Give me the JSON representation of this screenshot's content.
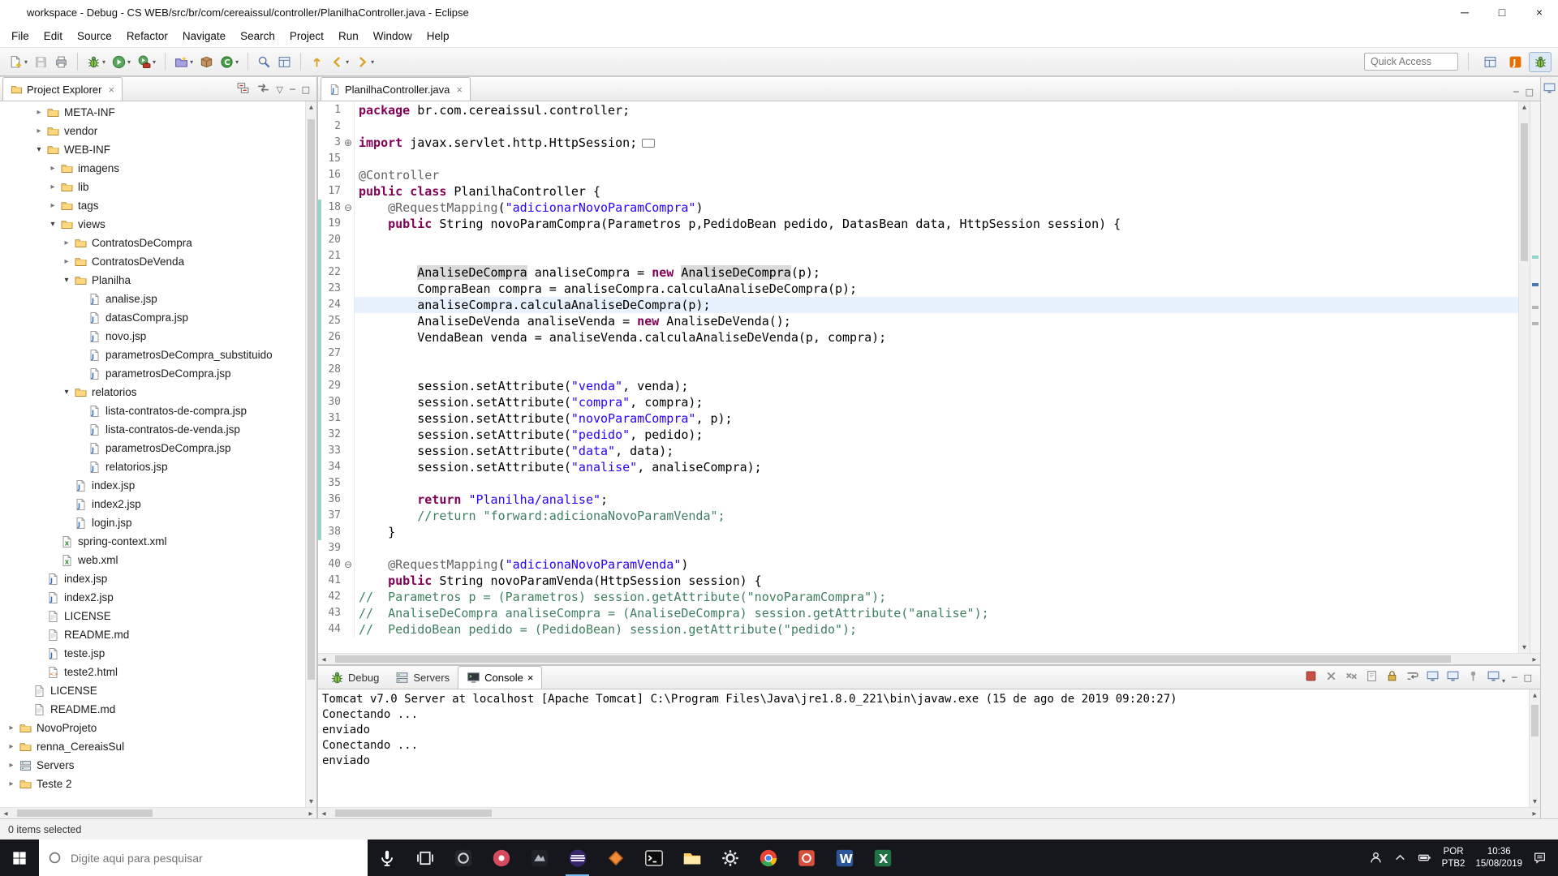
{
  "window": {
    "title": "workspace - Debug - CS WEB/src/br/com/cereaissul/controller/PlanilhaController.java - Eclipse"
  },
  "menu": {
    "items": [
      "File",
      "Edit",
      "Source",
      "Refactor",
      "Navigate",
      "Search",
      "Project",
      "Run",
      "Window",
      "Help"
    ]
  },
  "toolbar": {
    "quick_access_placeholder": "Quick Access",
    "groups": [
      [
        {
          "name": "new",
          "icon": "new-wizard",
          "dd": true
        },
        {
          "name": "save",
          "icon": "save",
          "disabled": true
        },
        {
          "name": "print",
          "icon": "print"
        }
      ],
      [
        {
          "name": "debug",
          "icon": "bug",
          "dd": true
        },
        {
          "name": "run",
          "icon": "run",
          "dd": true
        },
        {
          "name": "external-tools",
          "icon": "run-tool",
          "dd": true
        }
      ],
      [
        {
          "name": "new-java-project",
          "icon": "new-project",
          "dd": true
        },
        {
          "name": "new-package",
          "icon": "new-package"
        },
        {
          "name": "new-class",
          "icon": "new-class",
          "dd": true
        }
      ],
      [
        {
          "name": "search",
          "icon": "search"
        },
        {
          "name": "open-type",
          "icon": "grid"
        }
      ],
      [
        {
          "name": "last-edit-location",
          "icon": "last-edit"
        },
        {
          "name": "back",
          "icon": "back",
          "dd": true
        },
        {
          "name": "forward",
          "icon": "forward",
          "dd": true
        }
      ]
    ],
    "perspectives": [
      {
        "name": "open-perspective",
        "icon": "grid",
        "active": false
      },
      {
        "name": "javaee-perspective",
        "icon": "java",
        "active": false
      },
      {
        "name": "debug-perspective",
        "icon": "bug",
        "active": true
      }
    ]
  },
  "explorer": {
    "tab": "Project Explorer",
    "header_icons": [
      {
        "name": "collapse-all",
        "icon": "collapse-all"
      },
      {
        "name": "link-with-editor",
        "icon": "link"
      },
      {
        "name": "view-menu",
        "glyph": "▽"
      },
      {
        "name": "minimize-view",
        "glyph": "─"
      },
      {
        "name": "maximize-view",
        "glyph": "□"
      }
    ],
    "items": [
      {
        "label": "META-INF",
        "depth": 2,
        "icon": "folder",
        "state": "collapsed"
      },
      {
        "label": "vendor",
        "depth": 2,
        "icon": "folder",
        "state": "collapsed"
      },
      {
        "label": "WEB-INF",
        "depth": 2,
        "icon": "folder",
        "state": "expanded"
      },
      {
        "label": "imagens",
        "depth": 3,
        "icon": "folder",
        "state": "collapsed"
      },
      {
        "label": "lib",
        "depth": 3,
        "icon": "folder",
        "state": "collapsed"
      },
      {
        "label": "tags",
        "depth": 3,
        "icon": "folder",
        "state": "collapsed"
      },
      {
        "label": "views",
        "depth": 3,
        "icon": "folder",
        "state": "expanded"
      },
      {
        "label": "ContratosDeCompra",
        "depth": 4,
        "icon": "folder",
        "state": "collapsed"
      },
      {
        "label": "ContratosDeVenda",
        "depth": 4,
        "icon": "folder",
        "state": "collapsed"
      },
      {
        "label": "Planilha",
        "depth": 4,
        "icon": "folder",
        "state": "expanded"
      },
      {
        "label": "analise.jsp",
        "depth": 5,
        "icon": "jsp",
        "state": "leaf"
      },
      {
        "label": "datasCompra.jsp",
        "depth": 5,
        "icon": "jsp",
        "state": "leaf"
      },
      {
        "label": "novo.jsp",
        "depth": 5,
        "icon": "jsp",
        "state": "leaf"
      },
      {
        "label": "parametrosDeCompra_substituido",
        "depth": 5,
        "icon": "jsp",
        "state": "leaf"
      },
      {
        "label": "parametrosDeCompra.jsp",
        "depth": 5,
        "icon": "jsp",
        "state": "leaf"
      },
      {
        "label": "relatorios",
        "depth": 4,
        "icon": "folder",
        "state": "expanded"
      },
      {
        "label": "lista-contratos-de-compra.jsp",
        "depth": 5,
        "icon": "jsp",
        "state": "leaf"
      },
      {
        "label": "lista-contratos-de-venda.jsp",
        "depth": 5,
        "icon": "jsp",
        "state": "leaf"
      },
      {
        "label": "parametrosDeCompra.jsp",
        "depth": 5,
        "icon": "jsp",
        "state": "leaf"
      },
      {
        "label": "relatorios.jsp",
        "depth": 5,
        "icon": "jsp",
        "state": "leaf"
      },
      {
        "label": "index.jsp",
        "depth": 4,
        "icon": "jsp",
        "state": "leaf"
      },
      {
        "label": "index2.jsp",
        "depth": 4,
        "icon": "jsp",
        "state": "leaf"
      },
      {
        "label": "login.jsp",
        "depth": 4,
        "icon": "jsp",
        "state": "leaf"
      },
      {
        "label": "spring-context.xml",
        "depth": 3,
        "icon": "xml",
        "state": "leaf"
      },
      {
        "label": "web.xml",
        "depth": 3,
        "icon": "xml",
        "state": "leaf"
      },
      {
        "label": "index.jsp",
        "depth": 2,
        "icon": "jsp",
        "state": "leaf"
      },
      {
        "label": "index2.jsp",
        "depth": 2,
        "icon": "jsp",
        "state": "leaf"
      },
      {
        "label": "LICENSE",
        "depth": 2,
        "icon": "file",
        "state": "leaf"
      },
      {
        "label": "README.md",
        "depth": 2,
        "icon": "file",
        "state": "leaf"
      },
      {
        "label": "teste.jsp",
        "depth": 2,
        "icon": "jsp",
        "state": "leaf"
      },
      {
        "label": "teste2.html",
        "depth": 2,
        "icon": "html",
        "state": "leaf"
      },
      {
        "label": "LICENSE",
        "depth": 1,
        "icon": "file",
        "state": "leaf"
      },
      {
        "label": "README.md",
        "depth": 1,
        "icon": "file",
        "state": "leaf"
      },
      {
        "label": "NovoProjeto",
        "depth": 0,
        "icon": "folder",
        "state": "collapsed"
      },
      {
        "label": "renna_CereaisSul",
        "depth": 0,
        "icon": "folder",
        "state": "collapsed"
      },
      {
        "label": "Servers",
        "depth": 0,
        "icon": "server",
        "state": "collapsed"
      },
      {
        "label": "Teste 2",
        "depth": 0,
        "icon": "folder",
        "state": "collapsed"
      }
    ]
  },
  "editor": {
    "tab": "PlanilhaController.java",
    "header_icons": [
      {
        "name": "minimize-editor",
        "glyph": "─"
      },
      {
        "name": "maximize-editor",
        "glyph": "□"
      }
    ],
    "lines": [
      {
        "n": "1",
        "seg": [
          [
            "k",
            "package"
          ],
          [
            "p",
            " br.com.cereaissul.controller;"
          ]
        ]
      },
      {
        "n": "2",
        "seg": []
      },
      {
        "n": "3",
        "fold": "plus",
        "seg": [
          [
            "k",
            "import"
          ],
          [
            "p",
            " javax.servlet.http.HttpSession;"
          ],
          [
            "box",
            ""
          ]
        ]
      },
      {
        "n": "15",
        "seg": []
      },
      {
        "n": "16",
        "seg": [
          [
            "a",
            "@Controller"
          ]
        ]
      },
      {
        "n": "17",
        "seg": [
          [
            "k",
            "public"
          ],
          [
            "p",
            " "
          ],
          [
            "k",
            "class"
          ],
          [
            "p",
            " PlanilhaController {"
          ]
        ]
      },
      {
        "n": "18",
        "ch": true,
        "fold": "minus",
        "seg": [
          [
            "p",
            "    "
          ],
          [
            "a",
            "@RequestMapping"
          ],
          [
            "p",
            "("
          ],
          [
            "s",
            "\"adicionarNovoParamCompra\""
          ],
          [
            "p",
            ")"
          ]
        ]
      },
      {
        "n": "19",
        "ch": true,
        "seg": [
          [
            "p",
            "    "
          ],
          [
            "k",
            "public"
          ],
          [
            "p",
            " String novoParamCompra(Parametros p,PedidoBean pedido, DatasBean data, HttpSession session) {"
          ]
        ]
      },
      {
        "n": "20",
        "ch": true,
        "seg": []
      },
      {
        "n": "21",
        "ch": true,
        "seg": []
      },
      {
        "n": "22",
        "ch": true,
        "seg": [
          [
            "p",
            "        "
          ],
          [
            "h",
            "AnaliseDeCompra"
          ],
          [
            "p",
            " analiseCompra = "
          ],
          [
            "k",
            "new"
          ],
          [
            "p",
            " "
          ],
          [
            "h",
            "AnaliseDeCompra"
          ],
          [
            "p",
            "(p);"
          ]
        ]
      },
      {
        "n": "23",
        "ch": true,
        "seg": [
          [
            "p",
            "        CompraBean compra = analiseCompra.calculaAnaliseDeCompra(p);"
          ]
        ]
      },
      {
        "n": "24",
        "ch": true,
        "cur": true,
        "seg": [
          [
            "p",
            "        analiseCompra.calculaAnaliseDeCompra(p);"
          ]
        ]
      },
      {
        "n": "25",
        "ch": true,
        "seg": [
          [
            "p",
            "        AnaliseDeVenda analiseVenda = "
          ],
          [
            "k",
            "new"
          ],
          [
            "p",
            " AnaliseDeVenda();"
          ]
        ]
      },
      {
        "n": "26",
        "ch": true,
        "seg": [
          [
            "p",
            "        VendaBean venda = analiseVenda.calculaAnaliseDeVenda(p, compra);"
          ]
        ]
      },
      {
        "n": "27",
        "ch": true,
        "seg": []
      },
      {
        "n": "28",
        "ch": true,
        "seg": []
      },
      {
        "n": "29",
        "ch": true,
        "seg": [
          [
            "p",
            "        session.setAttribute("
          ],
          [
            "s",
            "\"venda\""
          ],
          [
            "p",
            ", venda);"
          ]
        ]
      },
      {
        "n": "30",
        "ch": true,
        "seg": [
          [
            "p",
            "        session.setAttribute("
          ],
          [
            "s",
            "\"compra\""
          ],
          [
            "p",
            ", compra);"
          ]
        ]
      },
      {
        "n": "31",
        "ch": true,
        "seg": [
          [
            "p",
            "        session.setAttribute("
          ],
          [
            "s",
            "\"novoParamCompra\""
          ],
          [
            "p",
            ", p);"
          ]
        ]
      },
      {
        "n": "32",
        "ch": true,
        "seg": [
          [
            "p",
            "        session.setAttribute("
          ],
          [
            "s",
            "\"pedido\""
          ],
          [
            "p",
            ", pedido);"
          ]
        ]
      },
      {
        "n": "33",
        "ch": true,
        "seg": [
          [
            "p",
            "        session.setAttribute("
          ],
          [
            "s",
            "\"data\""
          ],
          [
            "p",
            ", data);"
          ]
        ]
      },
      {
        "n": "34",
        "ch": true,
        "seg": [
          [
            "p",
            "        session.setAttribute("
          ],
          [
            "s",
            "\"analise\""
          ],
          [
            "p",
            ", analiseCompra);"
          ]
        ]
      },
      {
        "n": "35",
        "ch": true,
        "seg": []
      },
      {
        "n": "36",
        "ch": true,
        "seg": [
          [
            "p",
            "        "
          ],
          [
            "k",
            "return"
          ],
          [
            "p",
            " "
          ],
          [
            "s",
            "\"Planilha/analise\""
          ],
          [
            "p",
            ";"
          ]
        ]
      },
      {
        "n": "37",
        "ch": true,
        "seg": [
          [
            "p",
            "        "
          ],
          [
            "c",
            "//return \"forward:adicionaNovoParamVenda\";"
          ]
        ]
      },
      {
        "n": "38",
        "ch": true,
        "seg": [
          [
            "p",
            "    }"
          ]
        ]
      },
      {
        "n": "39",
        "seg": []
      },
      {
        "n": "40",
        "fold": "minus",
        "seg": [
          [
            "p",
            "    "
          ],
          [
            "a",
            "@RequestMapping"
          ],
          [
            "p",
            "("
          ],
          [
            "s",
            "\"adicionaNovoParamVenda\""
          ],
          [
            "p",
            ")"
          ]
        ]
      },
      {
        "n": "41",
        "seg": [
          [
            "p",
            "    "
          ],
          [
            "k",
            "public"
          ],
          [
            "p",
            " String novoParamVenda(HttpSession session) {"
          ]
        ]
      },
      {
        "n": "42",
        "seg": [
          [
            "c",
            "//  Parametros p = (Parametros) session.getAttribute(\"novoParamCompra\");"
          ]
        ]
      },
      {
        "n": "43",
        "seg": [
          [
            "c",
            "//  AnaliseDeCompra analiseCompra = (AnaliseDeCompra) session.getAttribute(\"analise\");"
          ]
        ]
      },
      {
        "n": "44",
        "seg": [
          [
            "c",
            "//  PedidoBean pedido = (PedidoBean) session.getAttribute(\"pedido\");"
          ]
        ]
      }
    ]
  },
  "console": {
    "tabs": [
      {
        "label": "Debug",
        "icon": "bug",
        "active": false
      },
      {
        "label": "Servers",
        "icon": "server",
        "active": false
      },
      {
        "label": "Console",
        "icon": "console",
        "active": true
      }
    ],
    "toolbar": [
      {
        "name": "terminate",
        "icon": "terminate"
      },
      {
        "name": "remove-launch",
        "icon": "remove"
      },
      {
        "name": "remove-all-terminated",
        "icon": "remove-all"
      },
      {
        "name": "clear-console",
        "icon": "clear"
      },
      {
        "name": "scroll-lock",
        "icon": "lock"
      },
      {
        "name": "word-wrap",
        "icon": "wrap"
      },
      {
        "name": "show-on-stdout",
        "icon": "monitor"
      },
      {
        "name": "show-on-stderr",
        "icon": "monitor"
      },
      {
        "name": "pin-console",
        "icon": "pin"
      },
      {
        "name": "open-console",
        "icon": "monitor",
        "dd": true
      },
      {
        "name": "minimize-console",
        "glyph": "─"
      },
      {
        "name": "maximize-console",
        "glyph": "□"
      }
    ],
    "header": "Tomcat v7.0 Server at localhost [Apache Tomcat] C:\\Program Files\\Java\\jre1.8.0_221\\bin\\javaw.exe (15 de ago de 2019 09:20:27)",
    "lines": [
      "Conectando ...",
      "enviado",
      "Conectando ...",
      "enviado"
    ]
  },
  "status": {
    "left": "0 items selected"
  },
  "taskbar": {
    "search_placeholder": "Digite aqui para pesquisar",
    "apps": [
      {
        "name": "task-view",
        "icon": "taskview",
        "open": false
      },
      {
        "name": "app-1",
        "icon": "app-dark",
        "open": false
      },
      {
        "name": "app-2",
        "icon": "app-red",
        "open": false
      },
      {
        "name": "app-3",
        "icon": "app-dark2",
        "open": false
      },
      {
        "name": "eclipse",
        "icon": "eclipse-app",
        "open": true
      },
      {
        "name": "app-4",
        "icon": "diamond",
        "open": false
      },
      {
        "name": "terminal",
        "icon": "terminal",
        "open": false
      },
      {
        "name": "file-explorer",
        "icon": "explorer",
        "open": false
      },
      {
        "name": "settings",
        "icon": "gear",
        "open": false
      },
      {
        "name": "chrome",
        "icon": "chrome",
        "open": false
      },
      {
        "name": "app-5",
        "icon": "red-tile",
        "open": false
      },
      {
        "name": "word",
        "icon": "word",
        "open": false
      },
      {
        "name": "excel",
        "icon": "excel",
        "open": false
      }
    ],
    "tray": {
      "lang_top": "POR",
      "lang_bottom": "PTB2",
      "time": "10:36",
      "date": "15/08/2019"
    }
  },
  "colors": {
    "keyword": "#7f0055",
    "string": "#2a00ff",
    "comment": "#3f7f5f",
    "annotation": "#646464",
    "current_line": "#e8f2fe",
    "occurrence": "#dbdbdb",
    "change_bar": "#93d4cc",
    "taskbar_bg": "#15171c",
    "open_app_indicator": "#76b9ed"
  }
}
